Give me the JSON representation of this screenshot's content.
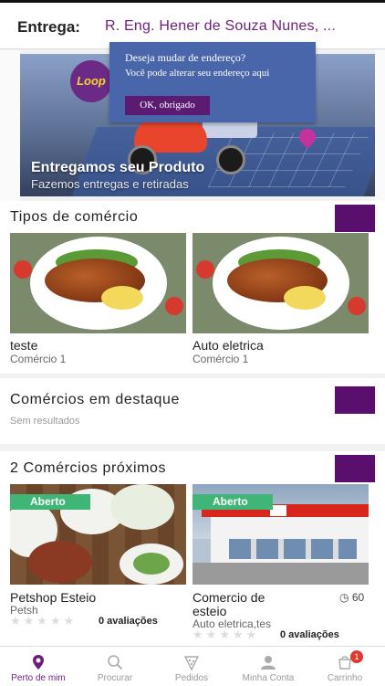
{
  "header": {
    "label": "Entrega:",
    "address": "R. Eng. Hener de Souza Nunes, ..."
  },
  "hero": {
    "logo_text": "Loop",
    "title": "Entregamos seu Produto",
    "subtitle": "Fazemos entregas e retiradas"
  },
  "tooltip": {
    "line1": "Deseja mudar de endereço?",
    "line2": "Você pode alterar seu endereço aqui",
    "ok_label": "OK, obrigado"
  },
  "tipos": {
    "title": "Tipos de comércio",
    "items": [
      {
        "name": "teste",
        "sub": "Comércio 1"
      },
      {
        "name": "Auto eletrica",
        "sub": "Comércio 1"
      }
    ]
  },
  "destaque": {
    "title": "Comércios em destaque",
    "empty": "Sem resultados"
  },
  "proximos": {
    "title": "2 Comércios próximos",
    "items": [
      {
        "badge": "Aberto",
        "name": "Petshop Esteio",
        "sub": "Petsh",
        "reviews": "0 avaliações",
        "rating": 0
      },
      {
        "badge": "Aberto",
        "name_line1": "Comercio de",
        "name_line2": "esteio",
        "sub": "Auto eletrica,tes",
        "reviews": "0 avaliações",
        "time": "60",
        "rating": 0
      }
    ]
  },
  "nav": {
    "items": [
      {
        "label": "Perto de mim",
        "icon": "location-pin-icon",
        "active": true
      },
      {
        "label": "Procurar",
        "icon": "search-icon",
        "active": false
      },
      {
        "label": "Pedidos",
        "icon": "pizza-icon",
        "active": false
      },
      {
        "label": "Minha Conta",
        "icon": "user-icon",
        "active": false
      },
      {
        "label": "Carrinho",
        "icon": "cart-icon",
        "active": false,
        "badge": "1"
      }
    ]
  },
  "colors": {
    "brand": "#6e1f7b",
    "square": "#5a0f6e",
    "open_badge": "#3fb576",
    "tooltip": "#4a66aa"
  }
}
